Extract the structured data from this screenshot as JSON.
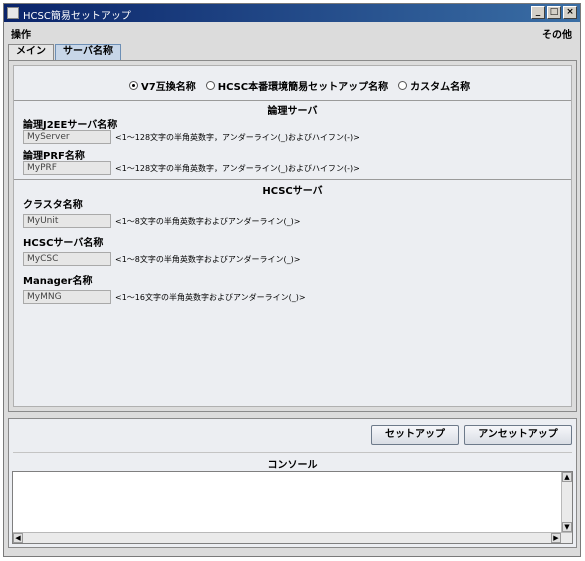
{
  "window": {
    "title": "HCSC簡易セットアップ"
  },
  "menu": {
    "left": "操作",
    "right": "その他"
  },
  "tabs": [
    {
      "label": "メイン"
    },
    {
      "label": "サーバ名称"
    }
  ],
  "naming_mode": {
    "options": [
      {
        "label": "V7互換名称",
        "selected": true
      },
      {
        "label": "HCSC本番環境簡易セットアップ名称",
        "selected": false
      },
      {
        "label": "カスタム名称",
        "selected": false
      }
    ]
  },
  "logical_server": {
    "title": "論理サーバ",
    "j2ee": {
      "label": "論理J2EEサーバ名称",
      "value": "MyServer",
      "hint": "<1～128文字の半角英数字，アンダーライン(_)およびハイフン(-)>"
    },
    "prf": {
      "label": "論理PRF名称",
      "value": "MyPRF",
      "hint": "<1～128文字の半角英数字，アンダーライン(_)およびハイフン(-)>"
    }
  },
  "hcsc_server": {
    "title": "HCSCサーバ",
    "cluster": {
      "label": "クラスタ名称",
      "value": "MyUnit",
      "hint": "<1～8文字の半角英数字およびアンダーライン(_)>"
    },
    "hcsc": {
      "label": "HCSCサーバ名称",
      "value": "MyCSC",
      "hint": "<1～8文字の半角英数字およびアンダーライン(_)>"
    },
    "manager": {
      "label": "Manager名称",
      "value": "MyMNG",
      "hint": "<1～16文字の半角英数字およびアンダーライン(_)>"
    }
  },
  "actions": {
    "setup": "セットアップ",
    "unsetup": "アンセットアップ"
  },
  "console": {
    "title": "コンソール"
  },
  "icons": {
    "minimize": "minimize-icon",
    "maximize": "maximize-icon",
    "close": "close-icon",
    "app": "app-icon"
  },
  "colors": {
    "titlebar_start": "#0a246a",
    "titlebar_end": "#3a6ea5",
    "selected_tab": "#c7d6e8"
  }
}
